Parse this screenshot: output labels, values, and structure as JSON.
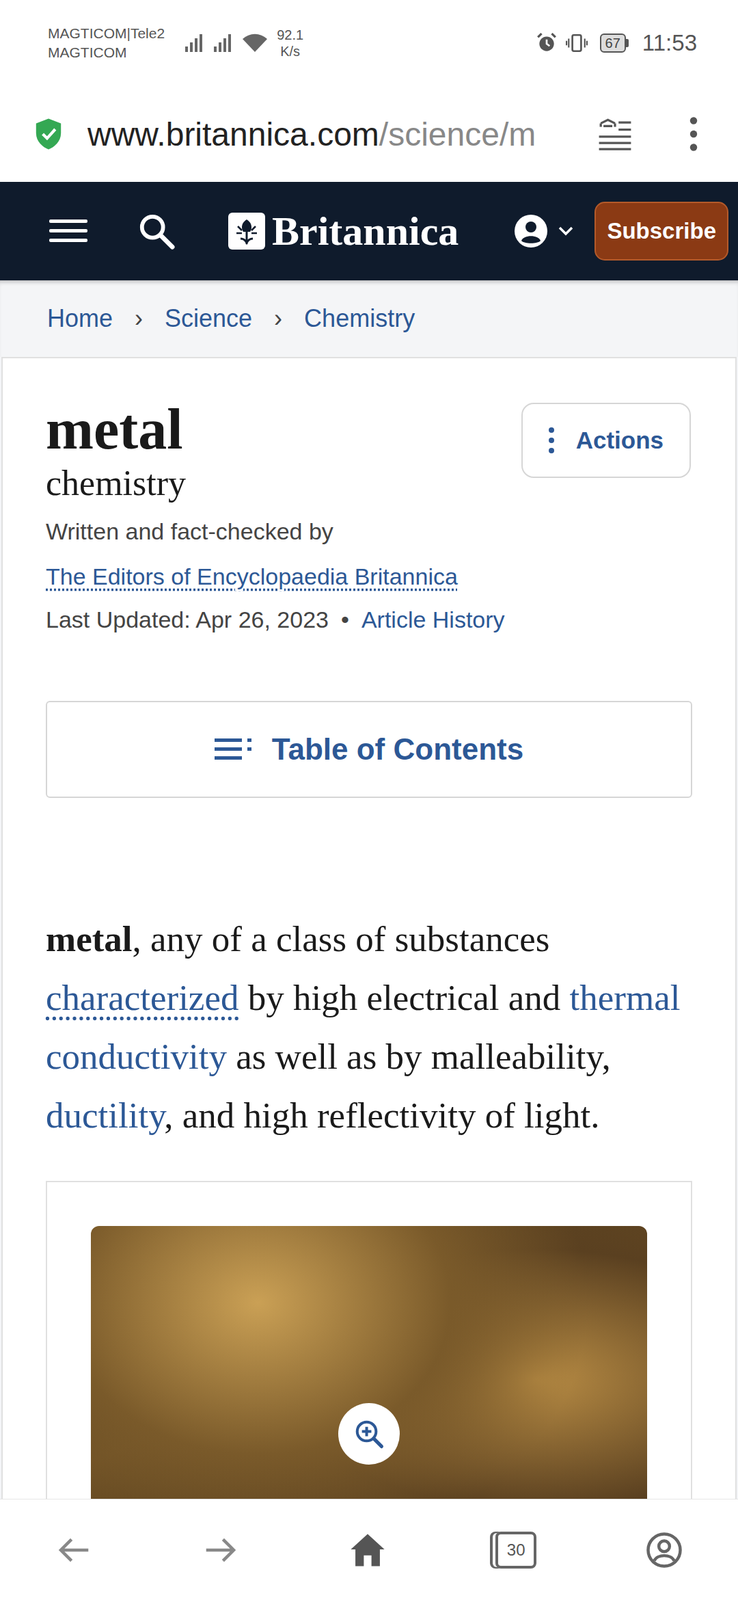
{
  "status_bar": {
    "carriers": [
      "MAGTICOM|Tele2",
      "MAGTICOM"
    ],
    "speed": "92.1",
    "speed_unit": "K/s",
    "battery": "67",
    "time": "11:53"
  },
  "address_bar": {
    "host": "www.britannica.com",
    "path": "/science/m"
  },
  "header": {
    "brand": "Britannica",
    "subscribe": "Subscribe"
  },
  "breadcrumbs": {
    "separator": "›",
    "items": [
      "Home",
      "Science",
      "Chemistry"
    ]
  },
  "article": {
    "title": "metal",
    "subtitle": "chemistry",
    "byline": "Written and fact-checked by",
    "author": "The Editors of Encyclopaedia Britannica",
    "updated": "Last Updated: Apr 26, 2023",
    "dot": "•",
    "history": "Article History",
    "actions": "Actions",
    "toc": "Table of Contents",
    "lead": [
      {
        "text": "metal",
        "kind": "bold"
      },
      {
        "text": ", any of a class of substances ",
        "kind": "plain"
      },
      {
        "text": "characterized",
        "kind": "dotted"
      },
      {
        "text": " by high electrical and ",
        "kind": "plain"
      },
      {
        "text": "thermal conductivity",
        "kind": "link"
      },
      {
        "text": " as well as by malleability, ",
        "kind": "plain"
      },
      {
        "text": "ductility",
        "kind": "link"
      },
      {
        "text": ", and high reflectivity of light.",
        "kind": "plain"
      }
    ]
  },
  "bottom_nav": {
    "tab_count": "30"
  }
}
